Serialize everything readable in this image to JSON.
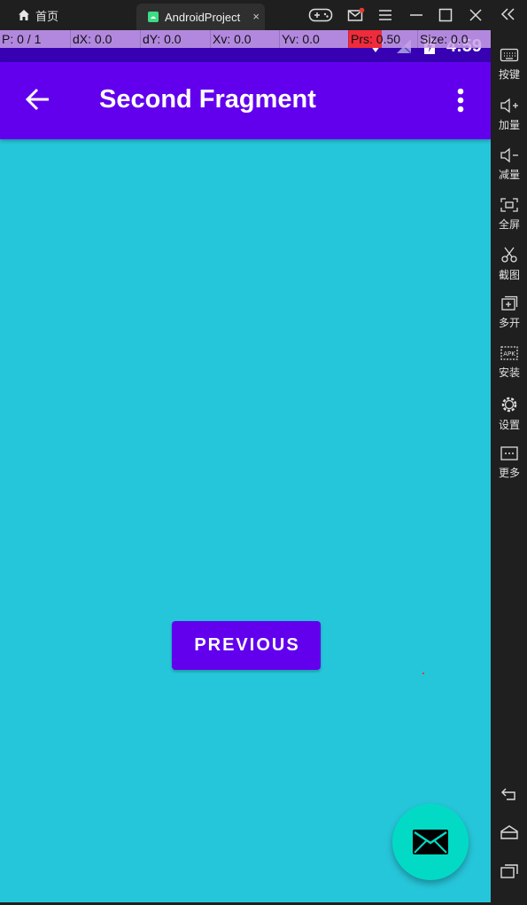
{
  "window": {
    "home_tab": "首页",
    "app_tab": "AndroidProject",
    "tab_close": "×"
  },
  "pointer_overlay": {
    "p": "P: 0 / 1",
    "dx": "dX: 0.0",
    "dy": "dY: 0.0",
    "xv": "Xv: 0.0",
    "yv": "Yv: 0.0",
    "prs": "Prs: 0.50",
    "size": "Size: 0.0"
  },
  "status_bar": {
    "time": "4:59"
  },
  "app_bar": {
    "title": "Second Fragment"
  },
  "content": {
    "previous_button": "PREVIOUS"
  },
  "side_panel": {
    "items": [
      {
        "label": "按键",
        "icon": "keyboard-icon"
      },
      {
        "label": "加量",
        "icon": "volume-up-icon"
      },
      {
        "label": "减量",
        "icon": "volume-down-icon"
      },
      {
        "label": "全屏",
        "icon": "fullscreen-icon"
      },
      {
        "label": "截图",
        "icon": "screenshot-icon"
      },
      {
        "label": "多开",
        "icon": "multi-instance-icon"
      },
      {
        "label": "安装",
        "icon": "apk-install-icon"
      },
      {
        "label": "设置",
        "icon": "settings-icon"
      },
      {
        "label": "更多",
        "icon": "more-icon"
      }
    ]
  },
  "colors": {
    "primary": "#6200ee",
    "primary_dark": "#3700b3",
    "secondary": "#03dac5",
    "background": "#26c6da"
  }
}
